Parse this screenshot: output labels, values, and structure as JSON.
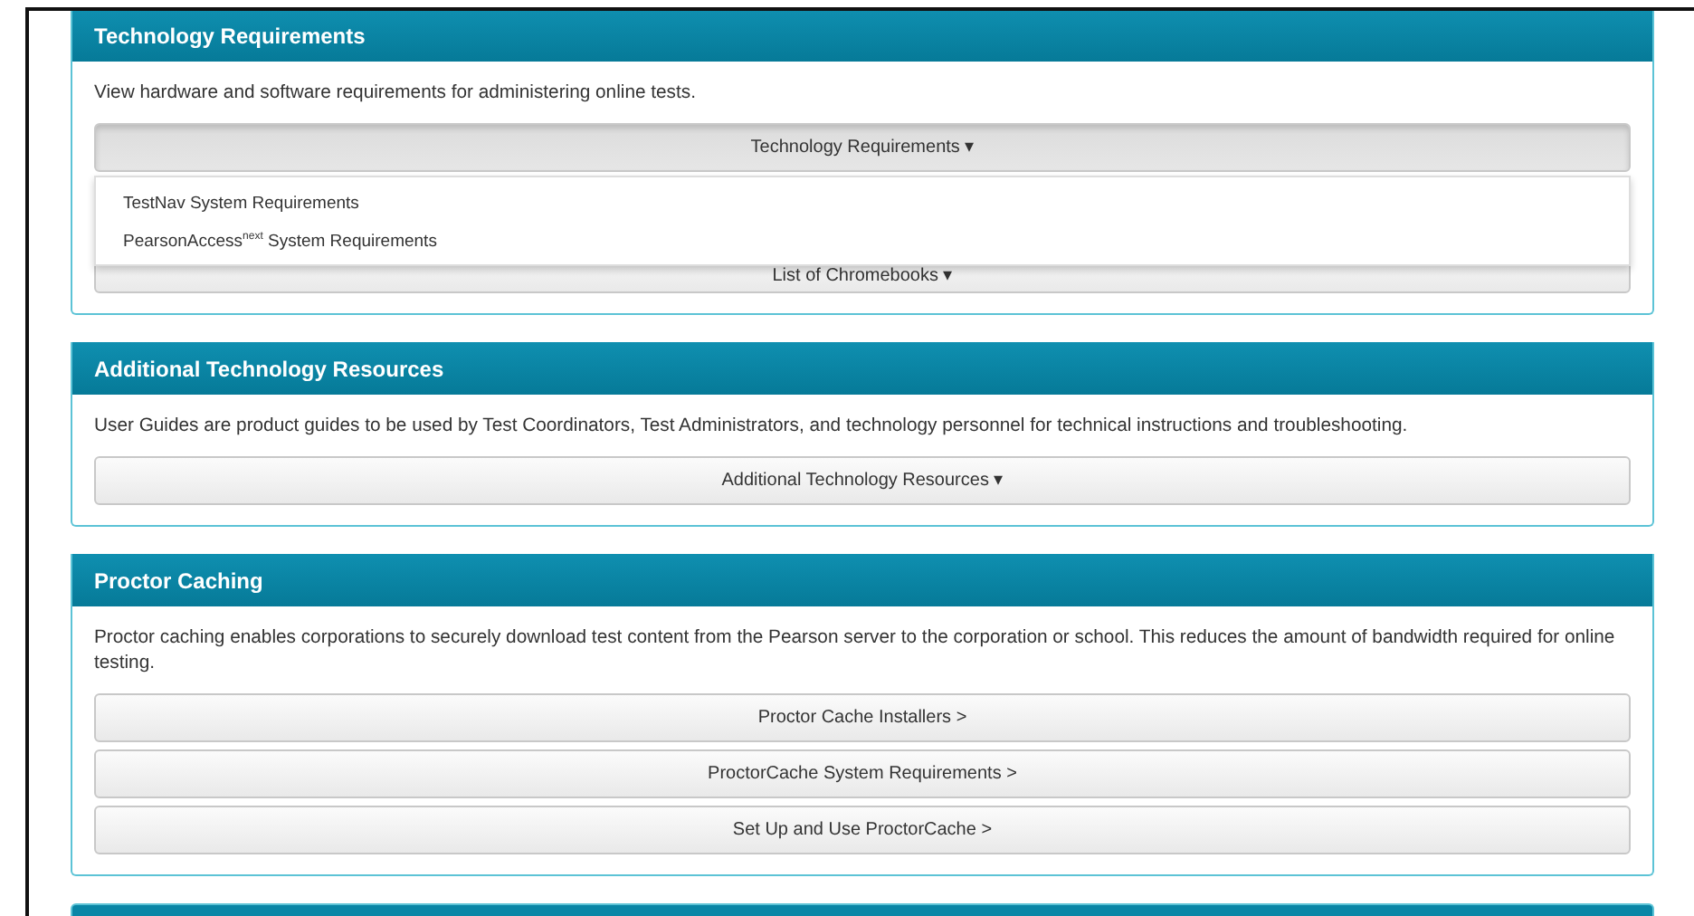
{
  "panels": [
    {
      "title": "Technology Requirements",
      "description": "View hardware and software requirements for administering online tests.",
      "buttons": [
        {
          "label": "Technology Requirements ▾",
          "expanded": true,
          "menu": [
            "TestNav System Requirements",
            "PearsonAccess$^{next}$ System Requirements"
          ]
        },
        {
          "label": "List of Chromebooks ▾",
          "expanded": false
        }
      ]
    },
    {
      "title": "Additional Technology Resources",
      "description": "User Guides are product guides to be used by Test Coordinators, Test Administrators, and technology personnel for technical instructions and troubleshooting.",
      "buttons": [
        {
          "label": "Additional Technology Resources ▾",
          "expanded": false
        }
      ]
    },
    {
      "title": "Proctor Caching",
      "description": "Proctor caching enables corporations to securely download test content from the Pearson server to the corporation or school. This reduces the amount of bandwidth required for online testing.",
      "buttons": [
        {
          "label": "Proctor Cache Installers >",
          "expanded": false
        },
        {
          "label": "ProctorCache System Requirements >",
          "expanded": false
        },
        {
          "label": "Set Up and Use ProctorCache >",
          "expanded": false
        }
      ]
    }
  ]
}
